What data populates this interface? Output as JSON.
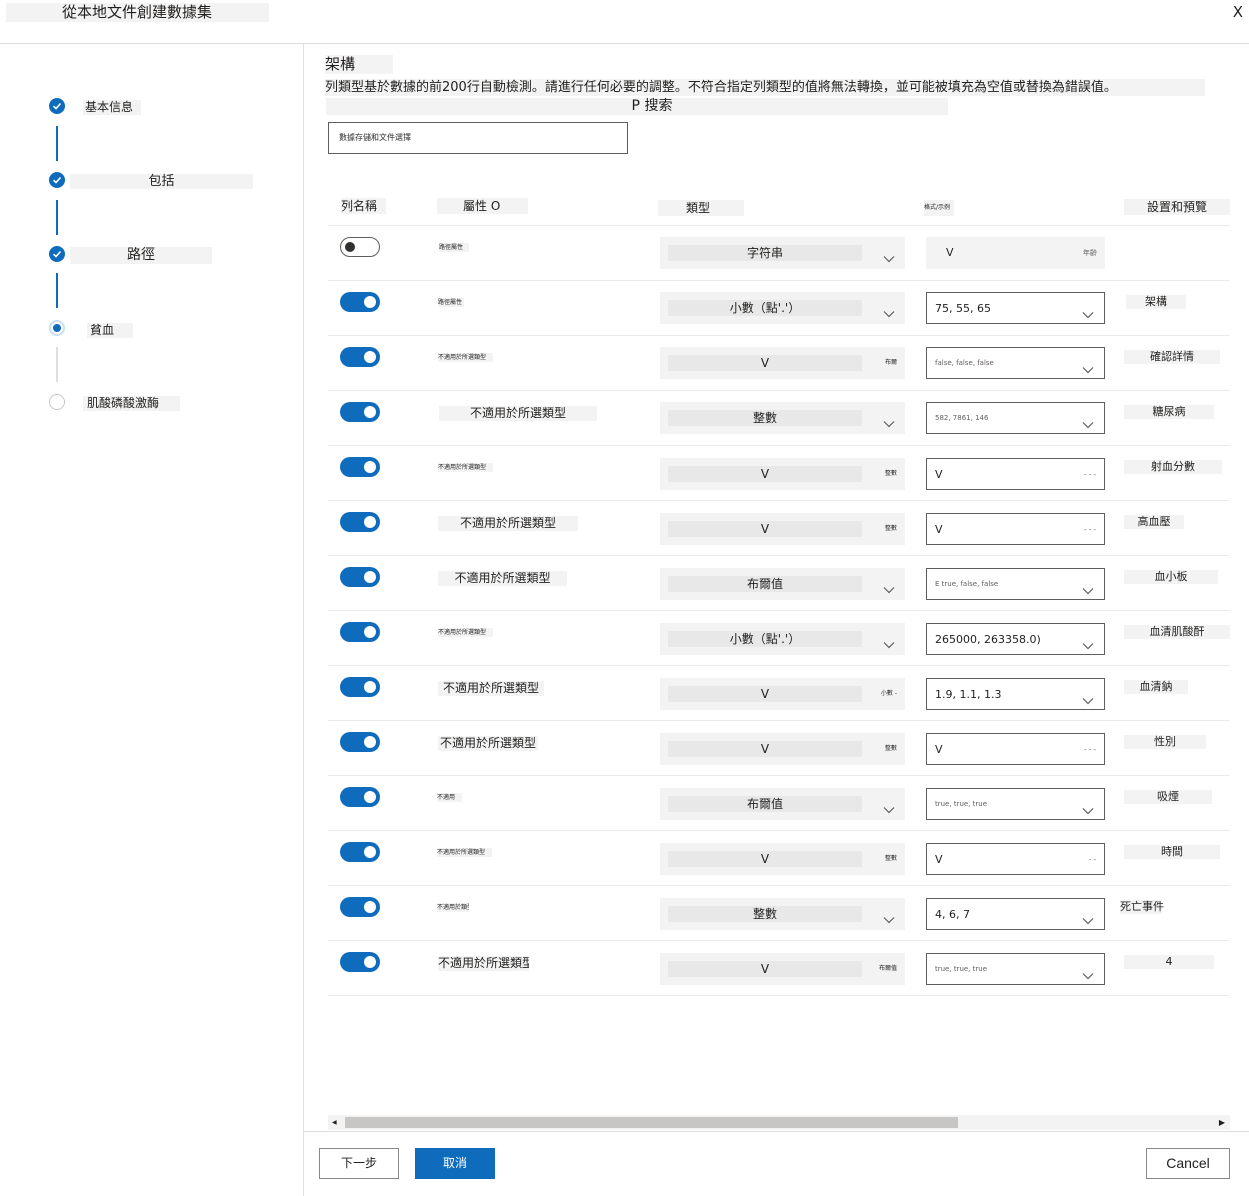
{
  "window": {
    "title": "從本地文件創建數據集",
    "close_label": "X"
  },
  "steps": [
    {
      "label": "基本信息",
      "state": "done"
    },
    {
      "label": "包括",
      "state": "done"
    },
    {
      "label": "路徑",
      "state": "done"
    },
    {
      "label": "貧血",
      "state": "current"
    },
    {
      "label": "肌酸磷酸激酶",
      "state": "todo"
    }
  ],
  "schema": {
    "title": "架構",
    "description": "列類型基於數據的前200行自動檢測。請進行任何必要的調整。不符合指定列類型的值將無法轉換，並可能被填充為空值或替換為錯誤值。",
    "search_label": "P 搜索",
    "search_value": "數據存儲和文件選擇"
  },
  "table": {
    "headers": {
      "include": "列名稱",
      "property": "屬性 O",
      "type": "類型",
      "format": "格式/示例",
      "settings": "設置和預覽"
    },
    "rows": [
      {
        "enabled": false,
        "property": "路徑屬性",
        "type": "字符串",
        "type_note": "",
        "format": "V ᅟ",
        "format_note": "年齡",
        "setting": ""
      },
      {
        "enabled": true,
        "property": "路徑屬性",
        "type": "小數（點'.'）",
        "type_note": "",
        "format": "75, 55, 65",
        "format_note": "",
        "setting": "架構"
      },
      {
        "enabled": true,
        "property": "不適用於所選類型",
        "type": "V",
        "type_note": "布爾",
        "format": "false, false, false",
        "format_note": "",
        "setting": "確認詳情"
      },
      {
        "enabled": true,
        "property": "不適用於所選類型",
        "type": "整數",
        "type_note": "",
        "format": "582, 7861, 146",
        "format_note": "",
        "setting": "糖尿病"
      },
      {
        "enabled": true,
        "property": "不適用於所選類型",
        "type": "V",
        "type_note": "整數",
        "format": "V",
        "format_note": "- - -",
        "setting": "射血分數"
      },
      {
        "enabled": true,
        "property": "不適用於所選類型",
        "type": "V",
        "type_note": "整數",
        "format": "V",
        "format_note": "- - -",
        "setting": "高血壓"
      },
      {
        "enabled": true,
        "property": "不適用於所選類型",
        "type": "布爾值",
        "type_note": "",
        "format": "E true, false, false",
        "format_note": "",
        "setting": "血小板"
      },
      {
        "enabled": true,
        "property": "不適用於所選類型",
        "type": "小數（點'.'）",
        "type_note": "",
        "format": "265000, 263358.0)",
        "format_note": "",
        "setting": "血清肌酸酐"
      },
      {
        "enabled": true,
        "property": "不適用於所選類型",
        "type": "V",
        "type_note": "小數 -",
        "format": "1.9, 1.1, 1.3",
        "format_note": "",
        "setting": "血清鈉"
      },
      {
        "enabled": true,
        "property": "不適用於所選類型",
        "type": "V",
        "type_note": "整數",
        "format": "V",
        "format_note": "- - -",
        "setting": "性別"
      },
      {
        "enabled": true,
        "property": "不適用",
        "type": "布爾值",
        "type_note": "",
        "format": "true, true, true",
        "format_note": "",
        "setting": "吸煙"
      },
      {
        "enabled": true,
        "property": "不適用於所選類型",
        "type": "V",
        "type_note": "整數",
        "format": "V",
        "format_note": "- -",
        "setting": "時間"
      },
      {
        "enabled": true,
        "property": "不適用於類型",
        "type": "整數",
        "type_note": "",
        "format": "4, 6, 7",
        "format_note": "",
        "setting": "死亡事件"
      },
      {
        "enabled": true,
        "property": "不適用於所選類型",
        "type": "V",
        "type_note": "布爾值",
        "format": "true, true, true",
        "format_note": "",
        "setting": "4"
      }
    ]
  },
  "footer": {
    "back_label": "下一步",
    "next_label": "取消",
    "cancel_label": "Cancel"
  },
  "colors": {
    "accent": "#0f6cbd",
    "panel": "#f3f3f3",
    "border": "#605e5c"
  }
}
